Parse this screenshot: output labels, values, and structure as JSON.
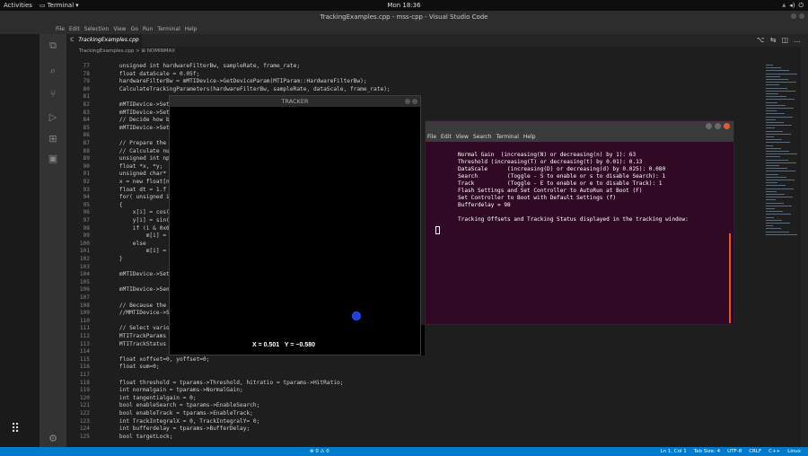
{
  "topbar": {
    "activities": "Activities",
    "app_name": "Terminal",
    "app_arrow": "▾",
    "clock": "Mon 18:36",
    "tray_icons": [
      "network-icon",
      "volume-icon",
      "power-icon"
    ]
  },
  "window": {
    "title": "TrackingExamples.cpp - mss-cpp - Visual Studio Code"
  },
  "menu": [
    "File",
    "Edit",
    "Selection",
    "View",
    "Go",
    "Run",
    "Terminal",
    "Help"
  ],
  "tab": {
    "icon": "C",
    "label": "TrackingExamples.cpp",
    "close": "×"
  },
  "breadcrumb": "TrackingExamples.cpp > ⊞ NOMINMAX",
  "editor": {
    "lines": [
      {
        "n": "77",
        "text": "    unsigned int hardwareFilterBw, sampleRate, frame_rate;"
      },
      {
        "n": "78",
        "text": "    float dataScale = 0.05f;"
      },
      {
        "n": "79",
        "text": "    hardwareFilterBw = mMTIDevice->GetDeviceParam(MTIParam::HardwareFilterBw);"
      },
      {
        "n": "80",
        "text": "    CalculateTrackingParameters(hardwareFilterBw, sampleRate, dataScale, frame_rate);"
      },
      {
        "n": "81",
        "text": ""
      },
      {
        "n": "82",
        "text": "    mMTIDevice->SetDe"
      },
      {
        "n": "83",
        "text": "    mMTIDevice->SetDe"
      },
      {
        "n": "84",
        "text": "    // Decide how big"
      },
      {
        "n": "85",
        "text": "    mMTIDevice->SetDe"
      },
      {
        "n": "86",
        "text": ""
      },
      {
        "n": "87",
        "text": "    // Prepare the nu"
      },
      {
        "n": "88",
        "text": "    // Calculate numb"
      },
      {
        "n": "89",
        "text": "    unsigned int npts"
      },
      {
        "n": "90",
        "text": "    float *x, *y;"
      },
      {
        "n": "91",
        "text": "    unsigned char* m;"
      },
      {
        "n": "92",
        "text": "    x = new float[npt"
      },
      {
        "n": "93",
        "text": "    float dt = 1.f /"
      },
      {
        "n": "94",
        "text": "    for( unsigned int"
      },
      {
        "n": "95",
        "text": "    {"
      },
      {
        "n": "96",
        "text": "        x[i] = cos( 1"
      },
      {
        "n": "97",
        "text": "        y[i] = sin( 2"
      },
      {
        "n": "98",
        "text": "        if (i & 0x000"
      },
      {
        "n": "99",
        "text": "            m[i] = 1;"
      },
      {
        "n": "100",
        "text": "        else"
      },
      {
        "n": "101",
        "text": "            m[i] = 0;"
      },
      {
        "n": "102",
        "text": "    }"
      },
      {
        "n": "103",
        "text": ""
      },
      {
        "n": "104",
        "text": "    mMTIDevice->SetDe"
      },
      {
        "n": "105",
        "text": ""
      },
      {
        "n": "106",
        "text": "    mMTIDevice->SendD"
      },
      {
        "n": "107",
        "text": ""
      },
      {
        "n": "108",
        "text": "    // Because the Ph"
      },
      {
        "n": "109",
        "text": "    //MMTIDevice->Set"
      },
      {
        "n": "110",
        "text": ""
      },
      {
        "n": "111",
        "text": "    // Select various"
      },
      {
        "n": "112",
        "text": "    MTITrackParams *t"
      },
      {
        "n": "113",
        "text": "    MTITrackStatus *t"
      },
      {
        "n": "114",
        "text": ""
      },
      {
        "n": "115",
        "text": "    float xoffset=0, yoffset=0;"
      },
      {
        "n": "116",
        "text": "    float sum=0;"
      },
      {
        "n": "117",
        "text": ""
      },
      {
        "n": "118",
        "text": "    float threshold = tparams->Threshold, hitratio = tparams->HitRatio;"
      },
      {
        "n": "119",
        "text": "    int normalgain = tparams->NormalGain;"
      },
      {
        "n": "120",
        "text": "    int tangentialgain = 0;"
      },
      {
        "n": "121",
        "text": "    bool enableSearch = tparams->EnableSearch;"
      },
      {
        "n": "122",
        "text": "    bool enableTrack = tparams->EnableTrack;"
      },
      {
        "n": "123",
        "text": "    int TrackIntegralX = 0, TrackIntegralY= 0;"
      },
      {
        "n": "124",
        "text": "    int bufferdelay = tparams->BufferDelay;"
      },
      {
        "n": "125",
        "text": "    bool targetLock;"
      }
    ]
  },
  "tracker": {
    "title": "TRACKER",
    "readout": "X = 0.501   Y = −0.580",
    "spot_color": "#1c3fd6"
  },
  "terminal": {
    "menu": [
      "File",
      "Edit",
      "View",
      "Search",
      "Terminal",
      "Help"
    ],
    "lines": [
      "Normal Gain  (increasing(N) or decreasing(n) by 1): 63",
      "Threshold (increasing(T) or decreasing(t) by 0.01): 0.13",
      "DataScale      (increasing(D) or decreasing(d) by 0.025): 0.080",
      "Search         (Toggle - S to enable or s to disable Search): 1",
      "Track          (Toggle - E to enable or e to disable Track): 1",
      "Flash Settings and Set Controller to AutoRun at Boot (F)",
      "Set Controller to Boot with Default Settings (f)",
      "Bufferdelay = 98",
      "",
      "Tracking Offsets and Tracking Status displayed in the tracking window:"
    ],
    "bg_color": "#300a24",
    "accent_color": "#e95420"
  },
  "statusbar": {
    "left": "⊗ 0  ⚠ 0",
    "right": [
      "Ln 1, Col 1",
      "Tab Size: 4",
      "UTF-8",
      "CRLF",
      "C++",
      "Linux"
    ]
  },
  "colors": {
    "status_blue": "#007acc",
    "editor_bg": "#1e1e1e"
  }
}
